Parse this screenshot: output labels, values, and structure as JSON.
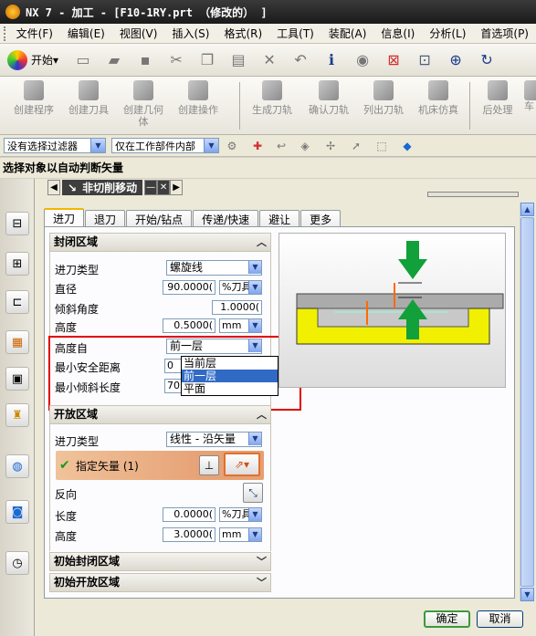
{
  "window": {
    "title": "NX 7 - 加工 - [F10-1RY.prt （修改的） ]"
  },
  "menu": [
    "文件(F)",
    "编辑(E)",
    "视图(V)",
    "插入(S)",
    "格式(R)",
    "工具(T)",
    "装配(A)",
    "信息(I)",
    "分析(L)",
    "首选项(P)"
  ],
  "toolbar": {
    "start_label": "开始",
    "start_arrow": "▾"
  },
  "mfg_toolbar": [
    "创建程序",
    "创建刀具",
    "创建几何体",
    "创建操作",
    "生成刀轨",
    "确认刀轨",
    "列出刀轨",
    "机床仿真",
    "后处理",
    "车"
  ],
  "selection": {
    "filter_value": "没有选择过滤器",
    "scope_value": "仅在工作部件内部"
  },
  "status_text": "选择对象以自动判断矢量",
  "dialog": {
    "title": "非切削移动",
    "tabs": [
      "进刀",
      "退刀",
      "开始/钻点",
      "传递/快速",
      "避让",
      "更多"
    ],
    "closed_region": {
      "header": "封闭区域",
      "labels": {
        "type": "进刀类型",
        "diameter": "直径",
        "ramp_angle": "倾斜角度",
        "height": "高度",
        "height_from": "高度自",
        "min_safe": "最小安全距离",
        "min_ramp": "最小倾斜长度"
      },
      "type_value": "螺旋线",
      "diameter_value": "90.0000(",
      "diameter_unit": "%刀具",
      "ramp_angle_value": "1.0000(",
      "height_value": "0.5000(",
      "height_unit": "mm",
      "height_from_value": "前一层",
      "min_safe_value": "0",
      "min_ramp_value": "70",
      "dropdown_options": [
        "当前层",
        "前一层",
        "平面"
      ],
      "dropdown_selected": "前一层"
    },
    "open_region": {
      "header": "开放区域",
      "labels": {
        "type": "进刀类型",
        "vector": "指定矢量 (1)",
        "reverse": "反向",
        "length": "长度",
        "height": "高度"
      },
      "type_value": "线性 - 沿矢量",
      "length_value": "0.0000(",
      "length_unit": "%刀具",
      "height_value": "3.0000(",
      "height_unit": "mm"
    },
    "initial_closed": "初始封闭区域",
    "initial_open": "初始开放区域",
    "ok": "确定",
    "cancel": "取消"
  },
  "colors": {
    "accent_red": "#e00000",
    "preview_yellow": "#f0f000",
    "arrow_green": "#11a03a",
    "vector_row": "#e7a276"
  }
}
